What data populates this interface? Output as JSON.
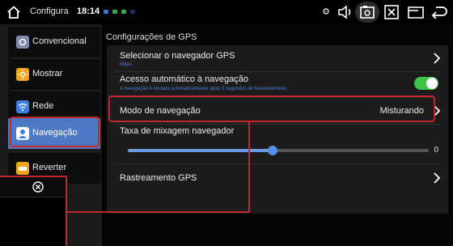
{
  "status_bar": {
    "app_name": "Configura",
    "time": "18:14",
    "icons": [
      "home-icon",
      "location-icon",
      "volume-icon",
      "screenshot-icon",
      "close-window-icon",
      "window-icon",
      "back-icon"
    ],
    "dot_colors": [
      "#3b6fd9",
      "#3aa64a",
      "#3aa64a",
      "#3b6fd9"
    ]
  },
  "sidebar": {
    "items": [
      {
        "label": "Convencional",
        "icon": "settings-icon",
        "icon_color": "#7e8aa8"
      },
      {
        "label": "Mostrar",
        "icon": "brightness-icon",
        "icon_color": "#f1a51d"
      },
      {
        "label": "Rede",
        "icon": "wifi-icon",
        "icon_color": "#3a7ee6"
      },
      {
        "label": "Navegação",
        "icon": "navigation-icon",
        "icon_color": "#3a7ee6",
        "active": true
      },
      {
        "label": "Reverter",
        "icon": "car-icon",
        "icon_color": "#f1a51d"
      }
    ]
  },
  "main": {
    "title": "Configurações de GPS",
    "rows": {
      "select_nav": {
        "label": "Selecionar o navegador GPS",
        "sub": "Maps"
      },
      "auto_access": {
        "label": "Acesso automático à navegação",
        "sub": "A navegação é iniciada automaticamente após 3 segundos de funcionamento",
        "enabled": true
      },
      "nav_mode": {
        "label": "Modo de navegação",
        "value": "Misturando"
      },
      "mix_rate": {
        "label": "Taxa de mixagem navegador",
        "value": "0",
        "slider_fraction": 0.48
      },
      "gps_tracking": {
        "label": "Rastreamento GPS"
      }
    }
  },
  "colors": {
    "accent_blue": "#4e79c4",
    "toggle_on": "#3cc44a",
    "annotation_red": "#c4262e"
  }
}
